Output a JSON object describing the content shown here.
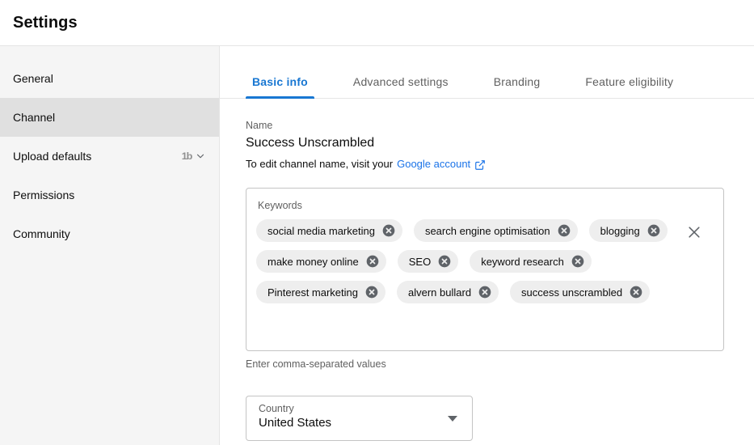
{
  "header": {
    "title": "Settings"
  },
  "sidebar": {
    "items": [
      {
        "label": "General",
        "active": false,
        "trailing": null
      },
      {
        "label": "Channel",
        "active": true,
        "trailing": null
      },
      {
        "label": "Upload defaults",
        "active": false,
        "trailing": {
          "glyph_text": "1b",
          "icon": "chevron-down-icon"
        }
      },
      {
        "label": "Permissions",
        "active": false,
        "trailing": null
      },
      {
        "label": "Community",
        "active": false,
        "trailing": null
      }
    ]
  },
  "main": {
    "tabs": [
      {
        "label": "Basic info",
        "active": true
      },
      {
        "label": "Advanced settings",
        "active": false
      },
      {
        "label": "Branding",
        "active": false
      },
      {
        "label": "Feature eligibility",
        "active": false
      }
    ],
    "name_field": {
      "label": "Name",
      "value": "Success Unscrambled",
      "hint_prefix": "To edit channel name, visit your",
      "hint_link": "Google account",
      "hint_link_icon": "external-link-icon"
    },
    "keywords_field": {
      "legend": "Keywords",
      "hint": "Enter comma-separated values",
      "clear_all_icon": "close-icon",
      "chips": [
        {
          "label": "social media marketing",
          "remove_icon": "remove-chip-icon"
        },
        {
          "label": "search engine optimisation",
          "remove_icon": "remove-chip-icon"
        },
        {
          "label": "blogging",
          "remove_icon": "remove-chip-icon"
        },
        {
          "label": "make money online",
          "remove_icon": "remove-chip-icon"
        },
        {
          "label": "SEO",
          "remove_icon": "remove-chip-icon"
        },
        {
          "label": "keyword research",
          "remove_icon": "remove-chip-icon"
        },
        {
          "label": "Pinterest marketing",
          "remove_icon": "remove-chip-icon"
        },
        {
          "label": "alvern bullard",
          "remove_icon": "remove-chip-icon"
        },
        {
          "label": "success unscrambled",
          "remove_icon": "remove-chip-icon"
        }
      ]
    },
    "country_field": {
      "label": "Country",
      "value": "United States",
      "arrow_icon": "dropdown-arrow-icon"
    }
  },
  "colors": {
    "accent_blue": "#1877d2",
    "link_blue": "#1a73e8",
    "sidebar_bg": "#f5f5f5",
    "sidebar_active_bg": "#e0e0e0",
    "chip_bg": "#eeeeee",
    "chip_remove": "#5f6368",
    "border": "#c4c4c4",
    "text_primary": "#0d0d0d",
    "text_secondary": "#606060"
  }
}
